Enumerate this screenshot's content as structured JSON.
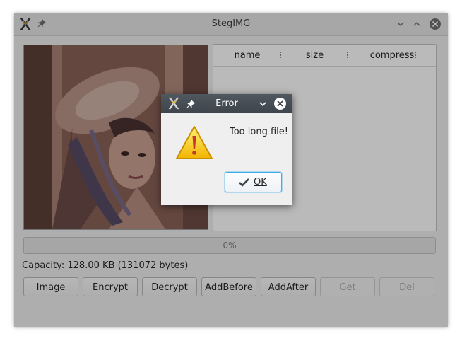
{
  "window": {
    "title": "StegIMG",
    "table_headers": [
      "name",
      "size",
      "compress"
    ],
    "progress_text": "0%",
    "progress_value": 0,
    "capacity_text": "Capacity: 128.00 KB (131072 bytes)",
    "buttons": [
      {
        "label": "Image",
        "enabled": true
      },
      {
        "label": "Encrypt",
        "enabled": true
      },
      {
        "label": "Decrypt",
        "enabled": true
      },
      {
        "label": "AddBefore",
        "enabled": true
      },
      {
        "label": "AddAfter",
        "enabled": true
      },
      {
        "label": "Get",
        "enabled": false
      },
      {
        "label": "Del",
        "enabled": false
      }
    ]
  },
  "dialog": {
    "title": "Error",
    "message": "Too long file!",
    "ok_label": "OK"
  },
  "colors": {
    "accent": "#3daee9",
    "dialog_titlebar": "#464d54",
    "warning": "#f5c400"
  }
}
